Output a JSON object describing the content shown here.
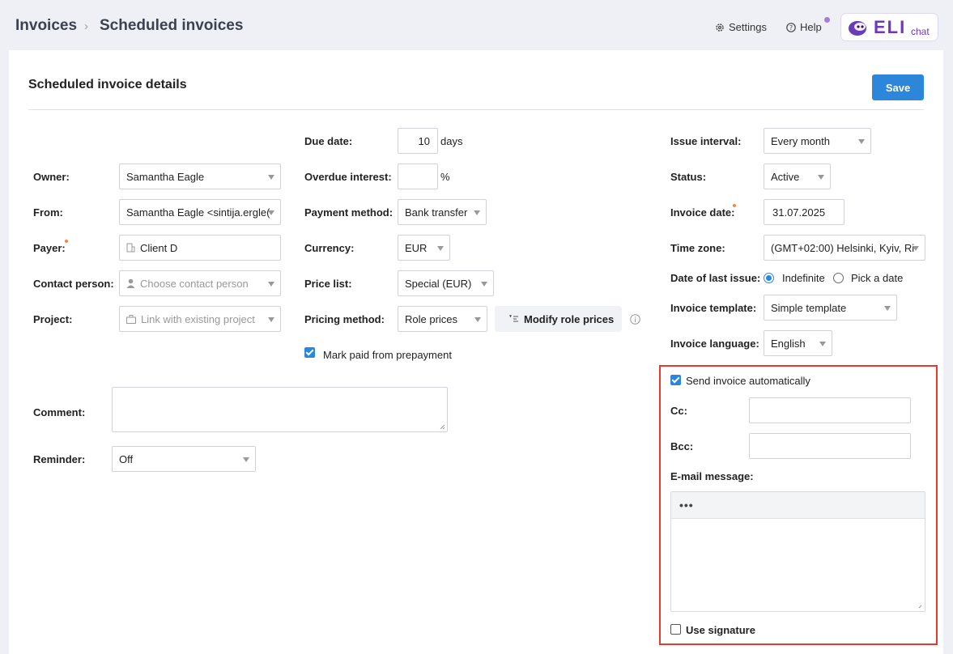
{
  "breadcrumb": {
    "root": "Invoices",
    "separator": "›",
    "current": "Scheduled invoices"
  },
  "header": {
    "settings": "Settings",
    "help": "Help",
    "brand": "ELI",
    "brand_sub": "chat"
  },
  "page": {
    "title": "Scheduled invoice details",
    "save": "Save"
  },
  "left": {
    "owner": {
      "label": "Owner:",
      "value": "Samantha Eagle"
    },
    "from": {
      "label": "From:",
      "value": "Samantha Eagle <sintija.ergle("
    },
    "payer": {
      "label": "Payer:",
      "value": "Client D"
    },
    "contact": {
      "label": "Contact person:",
      "placeholder": "Choose contact person"
    },
    "project": {
      "label": "Project:",
      "placeholder": "Link with existing project"
    },
    "comment": {
      "label": "Comment:",
      "value": ""
    },
    "reminder": {
      "label": "Reminder:",
      "value": "Off"
    }
  },
  "middle": {
    "due_date": {
      "label": "Due date:",
      "value": "10",
      "suffix": "days"
    },
    "overdue": {
      "label": "Overdue interest:",
      "value": "",
      "suffix": "%"
    },
    "payment": {
      "label": "Payment method:",
      "value": "Bank transfer"
    },
    "currency": {
      "label": "Currency:",
      "value": "EUR"
    },
    "price_list": {
      "label": "Price list:",
      "value": "Special (EUR)"
    },
    "pricing": {
      "label": "Pricing method:",
      "value": "Role prices"
    },
    "modify_roles": "Modify role prices",
    "mark_paid": "Mark paid from prepayment"
  },
  "right": {
    "issue_interval": {
      "label": "Issue interval:",
      "value": "Every month"
    },
    "status": {
      "label": "Status:",
      "value": "Active"
    },
    "invoice_date": {
      "label": "Invoice date:",
      "value": "31.07.2025"
    },
    "time_zone": {
      "label": "Time zone:",
      "value": "(GMT+02:00) Helsinki, Kyiv, Ri"
    },
    "last_issue": {
      "label": "Date of last issue:",
      "opt1": "Indefinite",
      "opt2": "Pick a date"
    },
    "template": {
      "label": "Invoice template:",
      "value": "Simple template"
    },
    "language": {
      "label": "Invoice language:",
      "value": "English"
    },
    "send_auto": "Send invoice automatically",
    "cc": {
      "label": "Cc:",
      "value": ""
    },
    "bcc": {
      "label": "Bcc:",
      "value": ""
    },
    "email_message": {
      "label": "E-mail message:",
      "toolbar": "•••",
      "value": ""
    },
    "use_signature": "Use signature"
  },
  "colors": {
    "accent": "#2c86d9",
    "highlight": "#e33b2e",
    "brand": "#7b3fc4"
  }
}
